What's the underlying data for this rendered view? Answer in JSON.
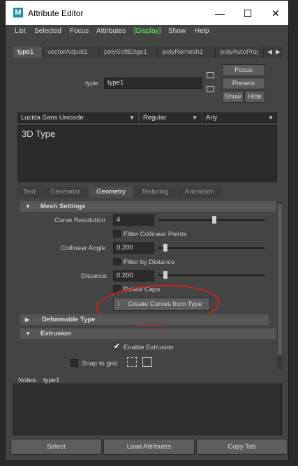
{
  "window": {
    "app_icon": "M",
    "title": "Attribute Editor",
    "minimize": "—",
    "maximize": "☐",
    "close": "✕"
  },
  "menu": [
    "List",
    "Selected",
    "Focus",
    "Attributes",
    "[Display]",
    "Show",
    "Help"
  ],
  "node_tabs": [
    "type1",
    "vectorAdjust1",
    "polySoftEdge1",
    "polyRemesh1",
    "polyAutoProj"
  ],
  "node_tabs_nav": {
    "left": "◀",
    "right": "▶"
  },
  "type_label": "type:",
  "type_value": "type1",
  "buttons": {
    "focus": "Focus",
    "presets": "Presets",
    "show": "Show",
    "hide": "Hide"
  },
  "font_family": "Lucida Sans Unicode",
  "font_style": "Regular",
  "font_script": "Any",
  "text_content": "3D Type",
  "sub_tabs": [
    "Text",
    "Generator",
    "Geometry",
    "Texturing",
    "Animation"
  ],
  "active_sub_tab": "Geometry",
  "mesh_settings": {
    "title": "Mesh Settings",
    "curve_resolution_label": "Curve Resolution",
    "curve_resolution": "4",
    "curve_resolution_slider": 0.5,
    "filter_collinear": "Filter Collinear Points",
    "filter_collinear_checked": false,
    "collinear_angle_label": "Collinear Angle",
    "collinear_angle": "0.200",
    "collinear_angle_slider": 0.02,
    "filter_distance": "Filter by Distance",
    "filter_distance_checked": false,
    "distance_label": "Distance",
    "distance": "0.200",
    "distance_slider": 0.02,
    "delete_caps": "Delete Caps",
    "delete_caps_checked": false,
    "create_curves": "Create Curves from Type"
  },
  "deformable_type": "Deformable Type",
  "extrusion": {
    "title": "Extrusion",
    "enable_extrusion": "Enable Extrusion",
    "enable_extrusion_checked": true,
    "snap_to_grid": "Snap to grid",
    "snap_to_grid_checked": false
  },
  "notes_label": "Notes:",
  "notes_node": "type1",
  "bottom_buttons": {
    "select": "Select",
    "load": "Load Attributes",
    "copy": "Copy Tab"
  },
  "colors": {
    "annotation": "#d21f1f",
    "display_menu": "#55ff55",
    "panel": "#444444"
  }
}
